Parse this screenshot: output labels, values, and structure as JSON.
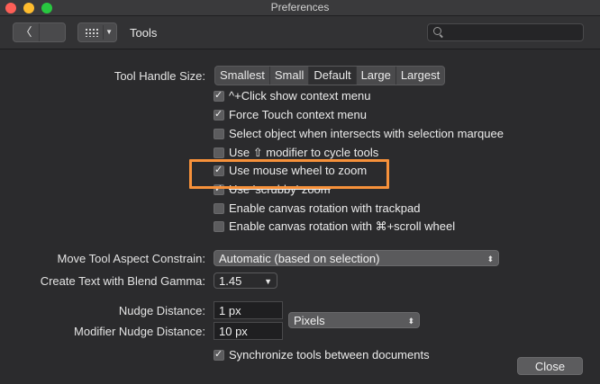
{
  "window": {
    "title": "Preferences"
  },
  "toolbar": {
    "section_title": "Tools",
    "search_placeholder": ""
  },
  "tool_handle": {
    "label": "Tool Handle Size:",
    "options": [
      "Smallest",
      "Small",
      "Default",
      "Large",
      "Largest"
    ],
    "selected": "Default"
  },
  "checkboxes": [
    {
      "label": "^+Click show context menu",
      "checked": true
    },
    {
      "label": "Force Touch context menu",
      "checked": true
    },
    {
      "label": "Select object when intersects with selection marquee",
      "checked": false
    },
    {
      "label": "Use ⇧ modifier to cycle tools",
      "checked": false
    },
    {
      "label": "Use mouse wheel to zoom",
      "checked": true
    },
    {
      "label": "Use 'scrubby' zoom",
      "checked": true
    },
    {
      "label": "Enable canvas rotation with trackpad",
      "checked": false
    },
    {
      "label": "Enable canvas rotation with ⌘+scroll wheel",
      "checked": false
    }
  ],
  "move_tool": {
    "label": "Move Tool Aspect Constrain:",
    "value": "Automatic (based on selection)"
  },
  "blend_gamma": {
    "label": "Create Text with Blend Gamma:",
    "value": "1.45"
  },
  "nudge": {
    "label": "Nudge Distance:",
    "value": "1 px"
  },
  "modifier_nudge": {
    "label": "Modifier Nudge Distance:",
    "value": "10 px"
  },
  "units": {
    "value": "Pixels"
  },
  "sync": {
    "label": "Synchronize tools between documents",
    "checked": true
  },
  "close_label": "Close",
  "colors": {
    "highlight": "#f7913a",
    "background": "#2b2b2d"
  }
}
